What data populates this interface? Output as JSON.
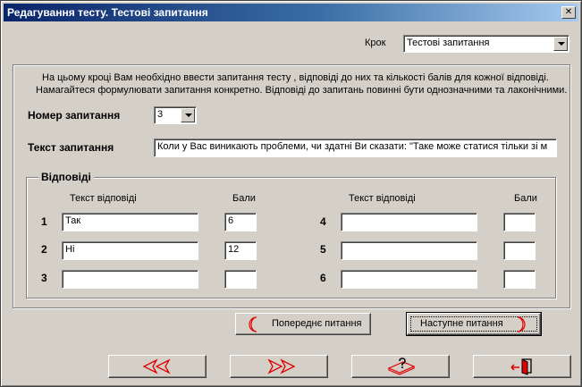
{
  "window": {
    "title": "Редагування тесту. Тестові запитання",
    "close_glyph": "✕"
  },
  "step": {
    "label": "Крок",
    "value": "Тестові запитання"
  },
  "instructions": {
    "line1": "На цьому кроці Вам необхідно ввести запитання тесту , відповіді до них та кількості балів для кожної відповіді.",
    "line2": "Намагайтеся формулювати запитання конкретно. Відповіді до запитань повинні бути однозначними та лаконічними."
  },
  "question_number": {
    "label": "Номер запитання",
    "value": "3"
  },
  "question_text": {
    "label": "Текст запитання",
    "value": "Коли у Вас виникають проблеми, чи здатні Ви сказати: \"Таке може статися тільки зі м"
  },
  "answers": {
    "group_title": "Відповіді",
    "col_text_header": "Текст відповіді",
    "col_score_header": "Бали",
    "rows": [
      {
        "num": "1",
        "text": "Так",
        "score": "6"
      },
      {
        "num": "2",
        "text": "Ні",
        "score": "12"
      },
      {
        "num": "3",
        "text": "",
        "score": ""
      },
      {
        "num": "4",
        "text": "",
        "score": ""
      },
      {
        "num": "5",
        "text": "",
        "score": ""
      },
      {
        "num": "6",
        "text": "",
        "score": ""
      }
    ]
  },
  "buttons": {
    "prev_question": "Попереднє питання",
    "next_question": "Наступне питання"
  },
  "icons": {
    "prev_question": "left-crescent-icon",
    "next_question": "right-crescent-icon",
    "back": "double-left-arrow-icon",
    "forward": "double-right-arrow-icon",
    "help": "book-question-icon",
    "exit": "exit-door-icon"
  },
  "colors": {
    "titlebar_start": "#0a246a",
    "titlebar_end": "#a6caf0",
    "icon_red": "#e00000",
    "face": "#d4d0c8"
  }
}
